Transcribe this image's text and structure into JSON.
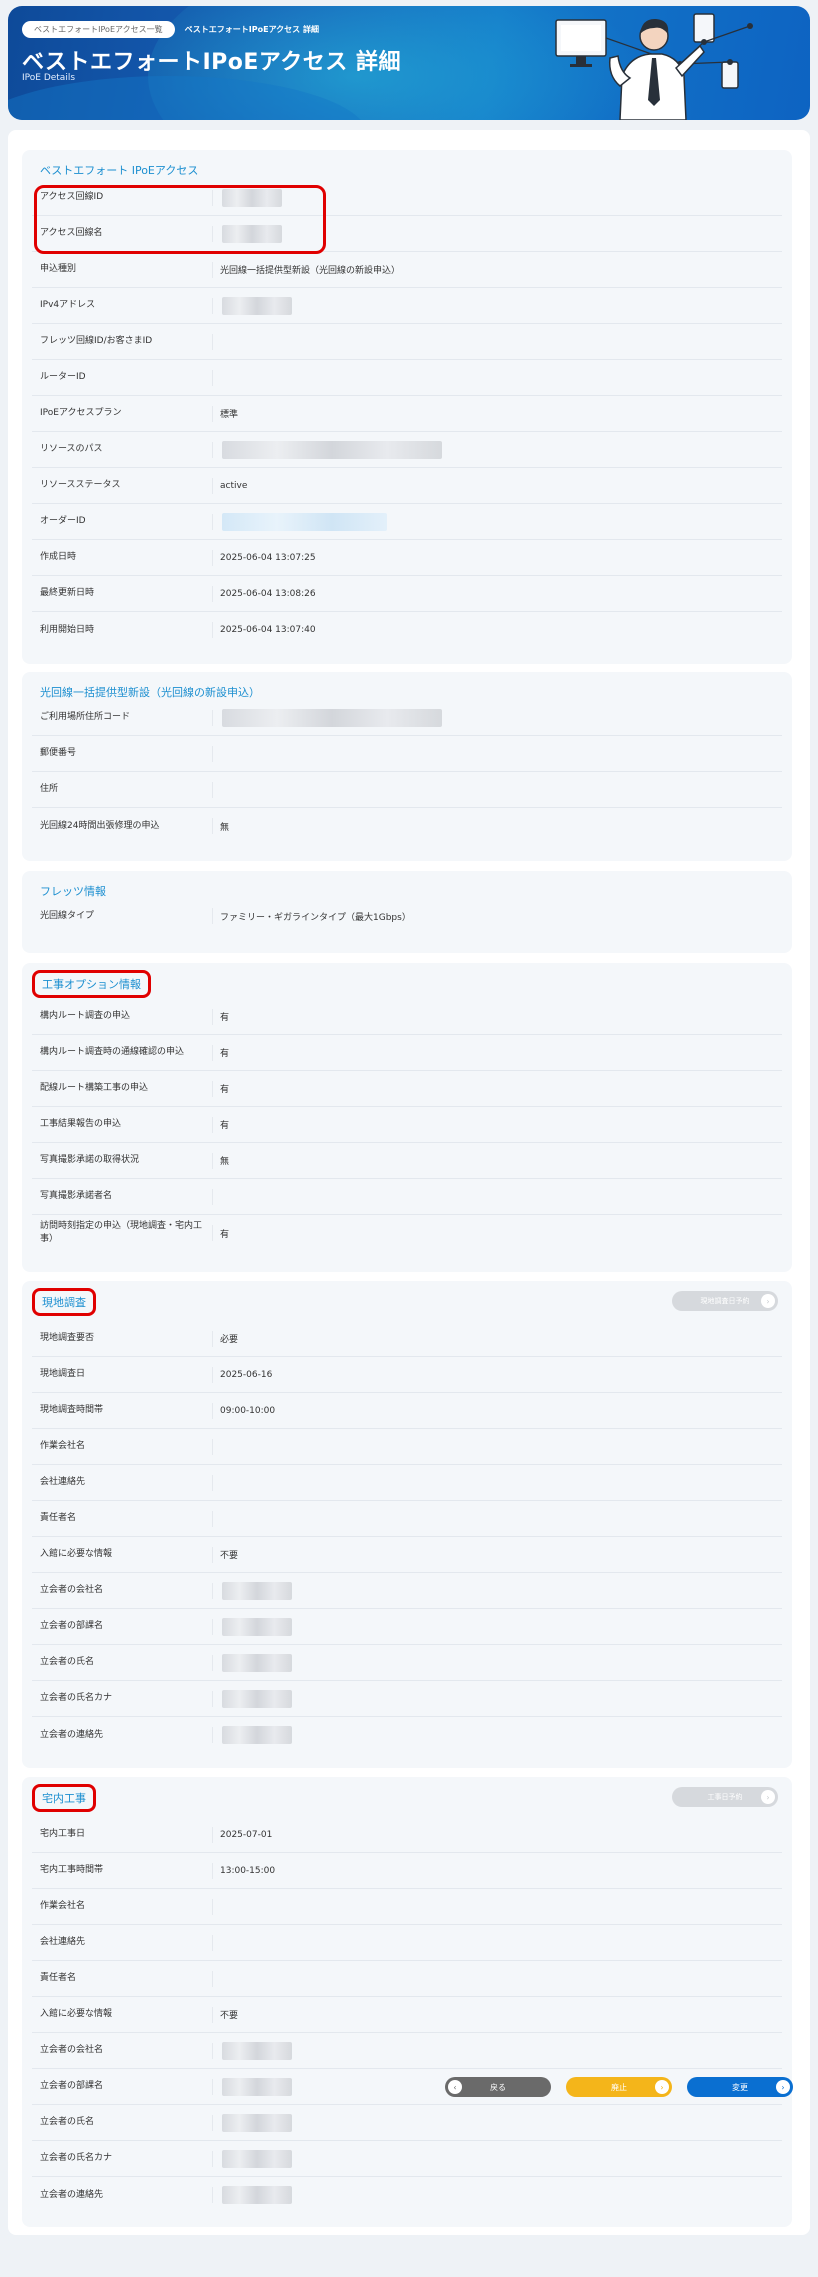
{
  "breadcrumb": {
    "parent": "ベストエフォートIPoEアクセス一覧",
    "current": "ベストエフォートIPoEアクセス 詳細"
  },
  "page": {
    "title": "ベストエフォートIPoEアクセス 詳細",
    "subtitle": "IPoE Details"
  },
  "sections": {
    "ipoe": {
      "title": "ベストエフォート IPoEアクセス",
      "rows": [
        {
          "label": "アクセス回線ID",
          "value": ""
        },
        {
          "label": "アクセス回線名",
          "value": ""
        },
        {
          "label": "申込種別",
          "value": "光回線一括提供型新設（光回線の新設申込）"
        },
        {
          "label": "IPv4アドレス",
          "value": ""
        },
        {
          "label": "フレッツ回線ID/お客さまID",
          "value": ""
        },
        {
          "label": "ルーターID",
          "value": ""
        },
        {
          "label": "IPoEアクセスプラン",
          "value": "標準"
        },
        {
          "label": "リソースのパス",
          "value": ""
        },
        {
          "label": "リソースステータス",
          "value": "active"
        },
        {
          "label": "オーダーID",
          "value": ""
        },
        {
          "label": "作成日時",
          "value": "2025-06-04 13:07:25"
        },
        {
          "label": "最終更新日時",
          "value": "2025-06-04 13:08:26"
        },
        {
          "label": "利用開始日時",
          "value": "2025-06-04 13:07:40"
        }
      ]
    },
    "hikari": {
      "title": "光回線一括提供型新設（光回線の新設申込）",
      "rows": [
        {
          "label": "ご利用場所住所コード",
          "value": ""
        },
        {
          "label": "郵便番号",
          "value": ""
        },
        {
          "label": "住所",
          "value": ""
        },
        {
          "label": "光回線24時間出張修理の申込",
          "value": "無"
        }
      ]
    },
    "flets": {
      "title": "フレッツ情報",
      "rows": [
        {
          "label": "光回線タイプ",
          "value": "ファミリー・ギガラインタイプ（最大1Gbps）"
        }
      ]
    },
    "koji": {
      "title": "工事オプション情報",
      "rows": [
        {
          "label": "構内ルート調査の申込",
          "value": "有"
        },
        {
          "label": "構内ルート調査時の通線確認の申込",
          "value": "有"
        },
        {
          "label": "配線ルート構築工事の申込",
          "value": "有"
        },
        {
          "label": "工事結果報告の申込",
          "value": "有"
        },
        {
          "label": "写真撮影承諾の取得状況",
          "value": "無"
        },
        {
          "label": "写真撮影承諾者名",
          "value": ""
        },
        {
          "label": "訪問時刻指定の申込（現地調査・宅内工事）",
          "value": "有"
        }
      ]
    },
    "genchi": {
      "title": "現地調査",
      "button": "現地調査日予約",
      "rows": [
        {
          "label": "現地調査要否",
          "value": "必要"
        },
        {
          "label": "現地調査日",
          "value": "2025-06-16"
        },
        {
          "label": "現地調査時間帯",
          "value": "09:00-10:00"
        },
        {
          "label": "作業会社名",
          "value": ""
        },
        {
          "label": "会社連絡先",
          "value": ""
        },
        {
          "label": "責任者名",
          "value": ""
        },
        {
          "label": "入館に必要な情報",
          "value": "不要"
        },
        {
          "label": "立会者の会社名",
          "value": ""
        },
        {
          "label": "立会者の部課名",
          "value": ""
        },
        {
          "label": "立会者の氏名",
          "value": ""
        },
        {
          "label": "立会者の氏名カナ",
          "value": ""
        },
        {
          "label": "立会者の連絡先",
          "value": ""
        }
      ]
    },
    "takunai": {
      "title": "宅内工事",
      "button": "工事日予約",
      "rows": [
        {
          "label": "宅内工事日",
          "value": "2025-07-01"
        },
        {
          "label": "宅内工事時間帯",
          "value": "13:00-15:00"
        },
        {
          "label": "作業会社名",
          "value": ""
        },
        {
          "label": "会社連絡先",
          "value": ""
        },
        {
          "label": "責任者名",
          "value": ""
        },
        {
          "label": "入館に必要な情報",
          "value": "不要"
        },
        {
          "label": "立会者の会社名",
          "value": ""
        },
        {
          "label": "立会者の部課名",
          "value": ""
        },
        {
          "label": "立会者の氏名",
          "value": ""
        },
        {
          "label": "立会者の氏名カナ",
          "value": ""
        },
        {
          "label": "立会者の連絡先",
          "value": ""
        }
      ]
    }
  },
  "footer": {
    "back": "戻る",
    "cancel": "廃止",
    "change": "変更"
  },
  "colors": {
    "accent": "#1c8fd0",
    "highlight": "#e00000",
    "back": "#6a6a6a",
    "cancel": "#f4b51a",
    "change": "#0a6fd1"
  },
  "icons": {
    "back": "arrow-left-icon",
    "cancel": "arrow-right-icon",
    "change": "arrow-right-icon",
    "reserve": "arrow-right-icon"
  }
}
